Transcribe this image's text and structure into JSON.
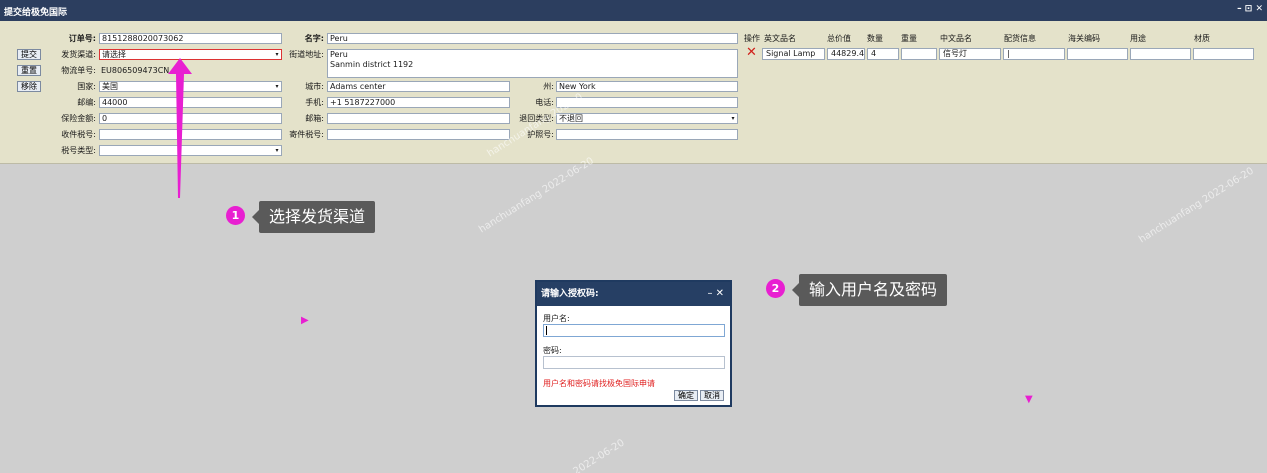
{
  "window": {
    "title": "提交给极免国际",
    "controls": "– ⊡ ✕"
  },
  "actions": {
    "submit": "提交",
    "reset": "重置",
    "remove": "移除"
  },
  "form": {
    "order_no": {
      "label": "订单号:",
      "value": "8151288020073062"
    },
    "channel": {
      "label": "发货渠道:",
      "value": "请选择"
    },
    "tracking_no": {
      "label": "物流单号:",
      "value": "EU806509473CN"
    },
    "country": {
      "label": "国家:",
      "value": "美国"
    },
    "zip": {
      "label": "邮编:",
      "value": "44000"
    },
    "insurance": {
      "label": "保险金额:",
      "value": "0"
    },
    "recipient_tax": {
      "label": "收件税号:",
      "value": ""
    },
    "tax_type": {
      "label": "税号类型:",
      "value": ""
    },
    "name": {
      "label": "名字:",
      "value": "Peru"
    },
    "street": {
      "label": "街道地址:",
      "line1": "Peru",
      "line2": "Sanmin district 1192"
    },
    "city": {
      "label": "城市:",
      "value": "Adams center"
    },
    "mobile": {
      "label": "手机:",
      "value": "+1 5187227000"
    },
    "email": {
      "label": "邮箱:",
      "value": ""
    },
    "sender_tax": {
      "label": "寄件税号:",
      "value": ""
    },
    "state": {
      "label": "州:",
      "value": "New York"
    },
    "phone": {
      "label": "电话:",
      "value": ""
    },
    "return_type": {
      "label": "退回类型:",
      "value": "不退回"
    },
    "passport": {
      "label": "护照号:",
      "value": ""
    }
  },
  "items_table": {
    "headers": [
      "操作",
      "英文品名",
      "总价值",
      "数量",
      "重量",
      "中文品名",
      "配货信息",
      "海关编码",
      "用途",
      "材质"
    ],
    "row": {
      "name_en": "Signal Lamp",
      "total_value": "44829.4",
      "qty": "4",
      "weight": "",
      "name_cn": "信号灯",
      "allocation": "|",
      "hs_code": "",
      "usage": "",
      "material": ""
    }
  },
  "annotations": {
    "step1": {
      "num": "1",
      "text": "选择发货渠道"
    },
    "step2": {
      "num": "2",
      "text": "输入用户名及密码"
    }
  },
  "dialog": {
    "title": "请输入授权码:",
    "controls": "– ✕",
    "username_label": "用户名:",
    "username_value": "",
    "password_label": "密码:",
    "password_value": "",
    "hint": "用户名和密码请找极免国际申请",
    "ok": "确定",
    "cancel": "取消"
  },
  "watermarks": [
    "hanchuanfang 2022-06-20",
    "hanchuanfang 2022-06-20",
    "hanchuanfang 2022-0",
    "2022-06-20"
  ],
  "colors": {
    "accent": "#e81fd1",
    "titlebar": "#2c3e5f",
    "form_bg": "#e4e2ca",
    "hint": "#e02020"
  }
}
